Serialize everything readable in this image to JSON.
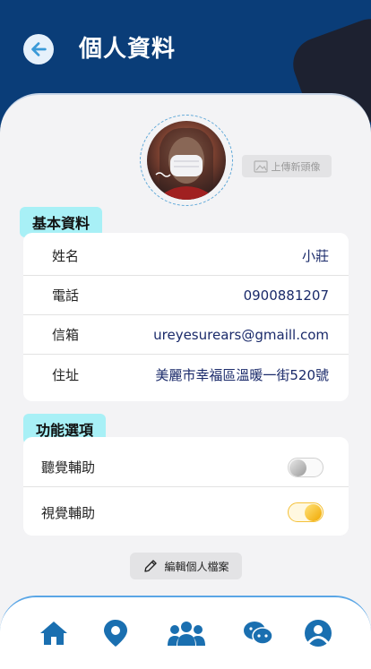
{
  "header": {
    "title": "個人資料"
  },
  "avatar": {
    "upload_label": "上傳新頭像"
  },
  "basic_info": {
    "title": "基本資料",
    "rows": [
      {
        "label": "姓名",
        "value": "小莊"
      },
      {
        "label": "電話",
        "value": "0900881207"
      },
      {
        "label": "信箱",
        "value": "ureyesurears@gmaill.com"
      },
      {
        "label": "住址",
        "value": "美麗市幸福區溫暖一街520號"
      }
    ]
  },
  "options": {
    "title": "功能選項",
    "rows": [
      {
        "label": "聽覺輔助",
        "enabled": false
      },
      {
        "label": "視覺輔助",
        "enabled": true
      }
    ]
  },
  "edit_label": "編輯個人檔案",
  "nav": [
    "home-icon",
    "location-pin-icon",
    "group-icon",
    "chat-icon",
    "profile-icon"
  ],
  "colors": {
    "header_bg": "#0a3d78",
    "accent": "#1a6fb0",
    "tag_bg": "#a8f0f6",
    "toggle_on": "#f4c13a"
  }
}
